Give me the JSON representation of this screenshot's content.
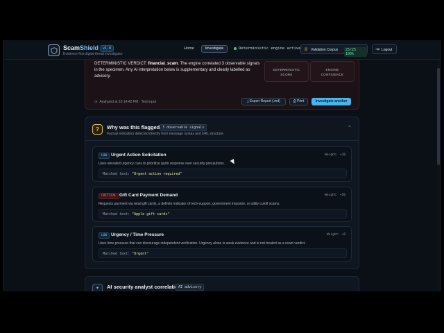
{
  "header": {
    "brand_main": "Scam",
    "brand_accent": "Shield",
    "version": "v1.0",
    "tagline": "Evidence-first digital threat investigator",
    "nav_home": "Home",
    "nav_investigate": "Investigate",
    "engine_status": "Deterministic engine active",
    "corpus_label": "Validation Corpus",
    "corpus_value": "25/25 100%",
    "logout_label": "Logout"
  },
  "verdict": {
    "prefix": "DETERMINISTIC VERDICT: ",
    "category": "financial_scam",
    "body": ". The engine correlated 3 observable signals in the specimen. Any AI interpretation below is supplementary and clearly labelled as advisory.",
    "score_label_1": "DETERMINISTIC",
    "score_label_2": "SCORE",
    "confidence_label_1": "ENGINE",
    "confidence_label_2": "CONFIDENCE",
    "analyzed": "Analyzed at 10:14:42 PM",
    "input_type": "Text input",
    "export_label": "Export Report (.md)",
    "print_label": "Print",
    "again_label": "Investigate another"
  },
  "flagged": {
    "title": "Why was this flagged?",
    "badge": "3 observable signals",
    "subtitle": "Factual indicators detected directly from message syntax and URL structure.",
    "signals": [
      {
        "severity": "LOW",
        "title": "Urgent Action Solicitation",
        "weight": "Weight: +18",
        "description": "Uses elevated urgency cues to prioritize quick response over security precautions.",
        "matched_label": "Matched text: ",
        "matched_value": "\"Urgent action required\""
      },
      {
        "severity": "CRITICAL",
        "title": "Gift Card Payment Demand",
        "weight": "Weight: +50",
        "description": "Requests payment via retail gift cards, a definite indicator of tech-support, government impostor, or utility cutoff scams.",
        "matched_label": "Matched text: ",
        "matched_value": "\"Apple gift cards\""
      },
      {
        "severity": "LOW",
        "title": "Urgency / Time Pressure",
        "weight": "Weight: +8",
        "description": "Uses time pressure that can discourage independent verification. Urgency alone is weak evidence and is not treated as a scam verdict.",
        "matched_label": "Matched text: ",
        "matched_value": "\"Urgent\""
      }
    ]
  },
  "ai": {
    "title": "AI security analyst correlation",
    "badge": "AI advisory"
  },
  "icons": {
    "logo": "shield-icon",
    "flag": "question-icon",
    "ai": "sparkle-icon",
    "corpus": "trophy-icon",
    "logout": "logout-icon"
  },
  "colors": {
    "accent": "#47b6ec",
    "critical": "#ff7b7b",
    "low": "#7fc6f0",
    "engine_ok": "#3ecf7a"
  }
}
